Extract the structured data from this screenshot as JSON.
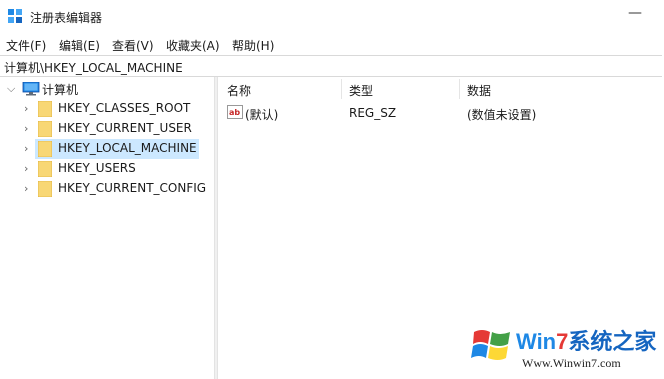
{
  "window": {
    "title": "注册表编辑器",
    "minimize_glyph": "—"
  },
  "menu": [
    {
      "label": "文件(F)"
    },
    {
      "label": "编辑(E)"
    },
    {
      "label": "查看(V)"
    },
    {
      "label": "收藏夹(A)"
    },
    {
      "label": "帮助(H)"
    }
  ],
  "address": {
    "path": "计算机\\HKEY_LOCAL_MACHINE"
  },
  "tree": {
    "root": {
      "label": "计算机",
      "icon": "computer-icon",
      "expanded": true
    },
    "children": [
      {
        "label": "HKEY_CLASSES_ROOT",
        "selected": false
      },
      {
        "label": "HKEY_CURRENT_USER",
        "selected": false
      },
      {
        "label": "HKEY_LOCAL_MACHINE",
        "selected": true
      },
      {
        "label": "HKEY_USERS",
        "selected": false
      },
      {
        "label": "HKEY_CURRENT_CONFIG",
        "selected": false
      }
    ]
  },
  "list": {
    "columns": [
      {
        "label": "名称"
      },
      {
        "label": "类型"
      },
      {
        "label": "数据"
      }
    ],
    "rows": [
      {
        "name": "(默认)",
        "type": "REG_SZ",
        "data": "(数值未设置)",
        "icon": "reg-string-icon"
      }
    ]
  },
  "watermark": {
    "brand_pre": "Win",
    "brand_num": "7",
    "brand_post": "系统之家",
    "url": "Www.Winwin7.com"
  },
  "colors": {
    "selection": "#cce8ff",
    "folder": "#f8d775",
    "accent": "#0078d7"
  }
}
